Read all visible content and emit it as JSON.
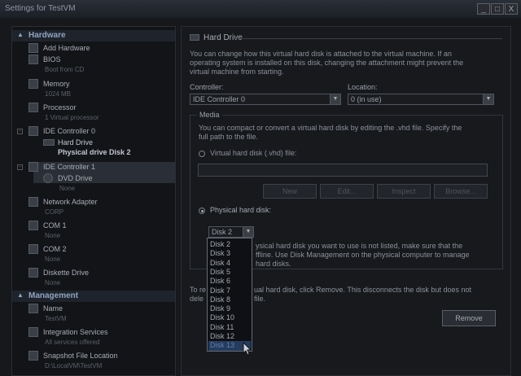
{
  "window": {
    "title": "Settings for TestVM",
    "btn_min": "_",
    "btn_max": "□",
    "btn_close": "X"
  },
  "sidebar": {
    "hardware_label": "Hardware",
    "management_label": "Management",
    "items": [
      {
        "name": "Add Hardware",
        "sub": ""
      },
      {
        "name": "BIOS",
        "sub": "Boot from CD"
      },
      {
        "name": "Memory",
        "sub": "1024 MB"
      },
      {
        "name": "Processor",
        "sub": "1 Virtual processor"
      },
      {
        "name": "IDE Controller 0",
        "sub": ""
      },
      {
        "name": "Hard Drive",
        "sub": "Physical drive Disk 2"
      },
      {
        "name": "IDE Controller 1",
        "sub": ""
      },
      {
        "name": "DVD Drive",
        "sub": "None"
      },
      {
        "name": "Network Adapter",
        "sub": "CORP"
      },
      {
        "name": "COM 1",
        "sub": "None"
      },
      {
        "name": "COM 2",
        "sub": "None"
      },
      {
        "name": "Diskette Drive",
        "sub": "None"
      }
    ],
    "mgmt_items": [
      {
        "name": "Name",
        "sub": "TestVM"
      },
      {
        "name": "Integration Services",
        "sub": "All services offered"
      },
      {
        "name": "Snapshot File Location",
        "sub": "D:\\LocalVM\\TestVM"
      }
    ]
  },
  "main": {
    "header": "Hard Drive",
    "intro": [
      "You can change how this virtual hard disk is attached to the virtual machine. If an",
      "operating system is installed on this disk, changing the attachment might prevent the",
      "virtual machine from starting."
    ],
    "controller_label": "Controller:",
    "controller_value": "IDE Controller 0",
    "location_label": "Location:",
    "location_value": "0 (in use)",
    "media_label": "Media",
    "media_text": [
      "You can compact or convert a virtual hard disk by editing the .vhd file. Specify the",
      "full path to the file."
    ],
    "vhd_radio_label": "Virtual hard disk (.vhd) file:",
    "vhd_path": "",
    "buttons": {
      "new": "New",
      "edit": "Edit...",
      "inspect": "Inspect",
      "browse": "Browse..."
    },
    "physical_radio_label": "Physical hard disk:",
    "physical_value": "Disk 2",
    "physical_note": [
      "ysical hard disk you want to use is not listed, make sure that the",
      "ffline. Use Disk Management on the physical computer to manage",
      "hard disks."
    ],
    "remove_text_left": [
      "To re",
      "dele"
    ],
    "remove_text_right": [
      "ual hard disk, click Remove. This disconnects the disk but does not",
      "file."
    ],
    "remove_button": "Remove",
    "disk_options": [
      "Disk 2",
      "Disk 3",
      "Disk 4",
      "Disk 5",
      "Disk 6",
      "Disk 7",
      "Disk 8",
      "Disk 9",
      "Disk 10",
      "Disk 11",
      "Disk 12",
      "Disk 13"
    ]
  }
}
